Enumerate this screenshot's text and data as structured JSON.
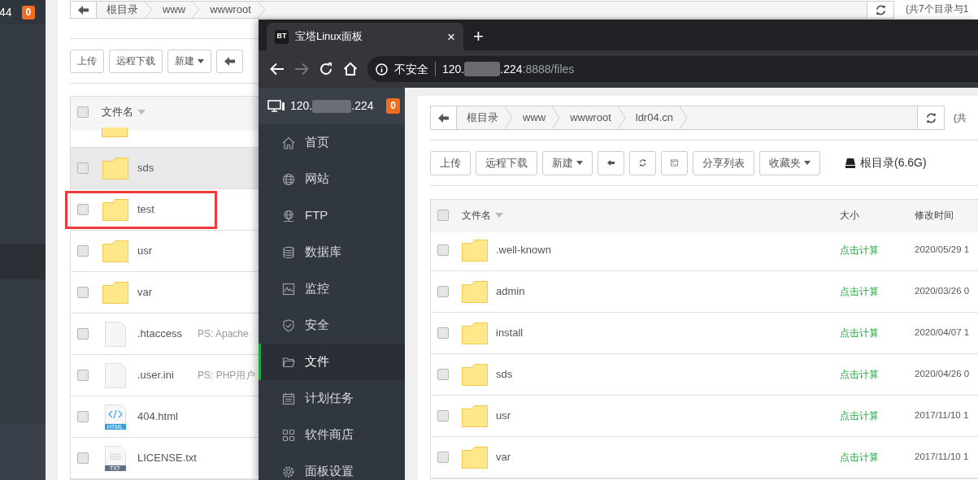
{
  "background_page": {
    "sidebar": {
      "host_tail": "44",
      "badge": "0"
    },
    "breadcrumb": [
      "根目录",
      "www",
      "wwwroot"
    ],
    "summary": "(共7个目录与1",
    "toolbar": [
      {
        "kind": "text",
        "label": "上传"
      },
      {
        "kind": "text",
        "label": "远程下载"
      },
      {
        "kind": "dropdown",
        "label": "新建"
      },
      {
        "kind": "back"
      }
    ],
    "table": {
      "column_1": "文件名",
      "select_all_checked": false,
      "rows": [
        {
          "kind": "folder",
          "name": "sds",
          "checked": false,
          "hovered": true,
          "marked": false
        },
        {
          "kind": "folder",
          "name": "test",
          "checked": false,
          "hovered": false,
          "marked": true
        },
        {
          "kind": "folder",
          "name": "usr",
          "checked": false,
          "hovered": false,
          "marked": false
        },
        {
          "kind": "folder",
          "name": "var",
          "checked": false,
          "hovered": false,
          "marked": false
        },
        {
          "kind": "file",
          "name": ".htaccess",
          "note": "PS: Apache",
          "checked": false,
          "hovered": false,
          "marked": false
        },
        {
          "kind": "file",
          "name": ".user.ini",
          "note": "PS: PHP用户",
          "checked": false,
          "hovered": false,
          "marked": false
        },
        {
          "kind": "html",
          "name": "404.html",
          "icon_label": "HTML",
          "checked": false,
          "hovered": false,
          "marked": false
        },
        {
          "kind": "txt",
          "name": "LICENSE.txt",
          "icon_label": "TXT",
          "checked": false,
          "hovered": false,
          "marked": false
        }
      ]
    }
  },
  "browser": {
    "tab": {
      "icon_text": "BT",
      "title": "宝塔Linux面板",
      "close": "×",
      "new_tab": "+"
    },
    "address": {
      "security": "不安全",
      "host_start": "120.",
      "host_end": ".224",
      "path": ":8888/files"
    },
    "panel": {
      "sidebar": {
        "host_start": "120.",
        "host_end": ".224",
        "badge": "0",
        "items": [
          {
            "kind": "home",
            "label": "首页",
            "selected": false
          },
          {
            "kind": "globe",
            "label": "网站",
            "selected": false
          },
          {
            "kind": "ftp",
            "label": "FTP",
            "selected": false
          },
          {
            "kind": "database",
            "label": "数据库",
            "selected": false
          },
          {
            "kind": "monitor",
            "label": "监控",
            "selected": false
          },
          {
            "kind": "shield",
            "label": "安全",
            "selected": false
          },
          {
            "kind": "folder",
            "label": "文件",
            "selected": true
          },
          {
            "kind": "calendar",
            "label": "计划任务",
            "selected": false
          },
          {
            "kind": "grid",
            "label": "软件商店",
            "selected": false
          },
          {
            "kind": "gear",
            "label": "面板设置",
            "selected": false
          }
        ]
      },
      "breadcrumb": [
        "根目录",
        "www",
        "wwwroot",
        "ldr04.cn"
      ],
      "summary": "(共",
      "toolbar": [
        {
          "kind": "text",
          "label": "上传"
        },
        {
          "kind": "text",
          "label": "远程下载"
        },
        {
          "kind": "dropdown",
          "label": "新建"
        },
        {
          "kind": "back"
        },
        {
          "kind": "refresh"
        },
        {
          "kind": "terminal"
        },
        {
          "kind": "text",
          "label": "分享列表"
        },
        {
          "kind": "dropdown",
          "label": "收藏夹"
        }
      ],
      "disk": "根目录(6.6G)",
      "table": {
        "columns": [
          "文件名",
          "大小",
          "修改时间"
        ],
        "select_all_checked": false,
        "rows": [
          {
            "name": ".well-known",
            "size": "点击计算",
            "modified": "2020/05/29 1",
            "checked": false
          },
          {
            "name": "admin",
            "size": "点击计算",
            "modified": "2020/03/26 0",
            "checked": false
          },
          {
            "name": "install",
            "size": "点击计算",
            "modified": "2020/04/07 1",
            "checked": false
          },
          {
            "name": "sds",
            "size": "点击计算",
            "modified": "2020/04/26 0",
            "checked": false
          },
          {
            "name": "usr",
            "size": "点击计算",
            "modified": "2017/11/10 1",
            "checked": false
          },
          {
            "name": "var",
            "size": "点击计算",
            "modified": "2017/11/10 1",
            "checked": false
          }
        ]
      }
    }
  }
}
